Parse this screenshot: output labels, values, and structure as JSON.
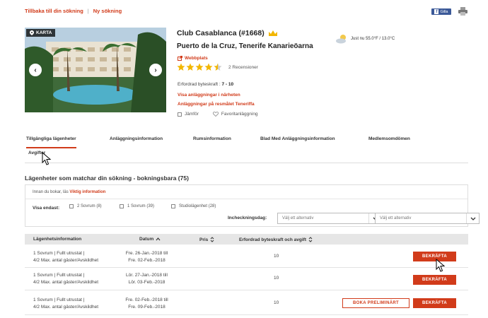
{
  "top_links": {
    "back": "Tillbaka till din sökning",
    "separator": "|",
    "new_search": "Ny sökning"
  },
  "share": {
    "label": "Gilla"
  },
  "gallery": {
    "map_label": "KARTA"
  },
  "hotel": {
    "name": "Club Casablanca (#1668)",
    "location": "Puerto de la Cruz, Tenerife  Kanarieöarna",
    "website": "Webbplats",
    "rating": 4.5,
    "reviews": "2 Recensioner",
    "demand_label": "Erfordrad byteskraft :",
    "demand_value": "7 - 10",
    "nearby_link": "Visa anläggningar i närheten",
    "destination_link": "Anläggningar på resmålet Teneriffa",
    "compare": "Jämför",
    "favorite": "Favoritanläggning"
  },
  "weather": {
    "text": "Just nu 55.0°F / 13.0°C"
  },
  "tabs": [
    {
      "label": "Tillgängliga lägenheter"
    },
    {
      "label": "Anläggningsinformation"
    },
    {
      "label": "Rumsinformation"
    },
    {
      "label": "Blad Med Anläggningsinformation"
    },
    {
      "label": "Medlemsomdömen"
    },
    {
      "label": "Avgifter"
    }
  ],
  "section": {
    "title": "Lägenheter som matchar din sökning - bokningsbara (75)"
  },
  "filter": {
    "info_prefix": "Innan du bokar, läs",
    "info_link": "Viktig information",
    "visa_label": "Visa endast:",
    "options": [
      "2 Sovrum (8)",
      "1 Sovrum (39)",
      "Studiolägenhet (28)"
    ],
    "checkin_label": "Incheckningsdag:",
    "select_placeholder": "Välj ett alternativ",
    "range_arrow": "→"
  },
  "table": {
    "headers": [
      "Lägenhetsinformation",
      "Datum",
      "Pris",
      "Erfordrad byteskraft och avgift"
    ],
    "rows": [
      {
        "info1": "1 Sovrum | Fullt utrustat |",
        "info2": "4/2 Max. antal gäster/Avskildhet",
        "date1": "Fre. 26-Jan.-2018 till",
        "date2": "Fre. 02-Feb.-2018",
        "kraft": "10",
        "confirm": "BEKRÄFTA"
      },
      {
        "info1": "1 Sovrum | Fullt utrustat |",
        "info2": "4/2 Max. antal gäster/Avskildhet",
        "date1": "Lör. 27-Jan.-2018 till",
        "date2": "Lör. 03-Feb.-2018",
        "kraft": "10",
        "confirm": "BEKRÄFTA"
      },
      {
        "info1": "1 Sovrum | Fullt utrustat |",
        "info2": "4/2 Max. antal gäster/Avskildhet",
        "date1": "Fre. 02-Feb.-2018 till",
        "date2": "Fre. 09-Feb.-2018",
        "kraft": "10",
        "prelim": "BOKA PRELIMINÄRT",
        "confirm": "BEKRÄFTA"
      }
    ]
  },
  "colors": {
    "accent": "#d13b1a",
    "star": "#f2b600",
    "table_header": "#e6e6e6"
  }
}
